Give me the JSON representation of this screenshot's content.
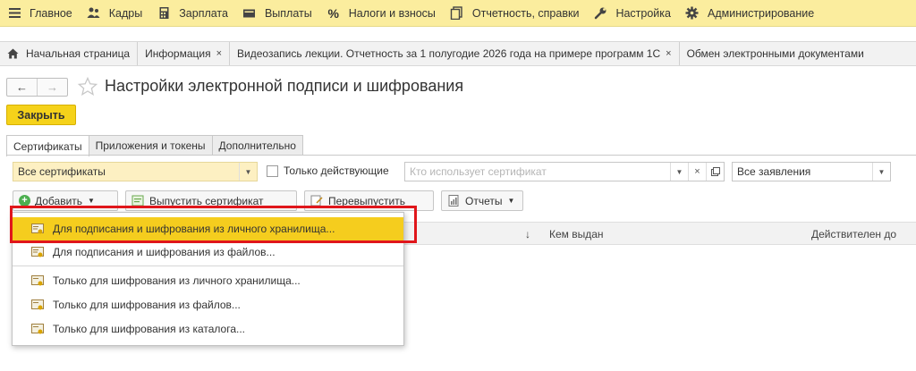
{
  "top_menu": [
    {
      "label": "Главное",
      "icon": "menu-lines-icon"
    },
    {
      "label": "Кадры",
      "icon": "people-icon"
    },
    {
      "label": "Зарплата",
      "icon": "calculator-icon"
    },
    {
      "label": "Выплаты",
      "icon": "wallet-icon"
    },
    {
      "label": "Налоги и взносы",
      "icon": "percent-icon"
    },
    {
      "label": "Отчетность, справки",
      "icon": "documents-icon"
    },
    {
      "label": "Настройка",
      "icon": "wrench-icon"
    },
    {
      "label": "Администрирование",
      "icon": "gear-icon"
    }
  ],
  "open_tabs": {
    "home": "Начальная страница",
    "items": [
      {
        "label": "Информация"
      },
      {
        "label": "Видеозапись лекции. Отчетность за 1 полугодие 2026 года на примере программ 1С"
      },
      {
        "label": "Обмен электронными документами"
      }
    ],
    "close_glyph": "×"
  },
  "page": {
    "title": "Настройки электронной подписи и шифрования",
    "back_glyph": "←",
    "forward_glyph": "→",
    "close_button": "Закрыть"
  },
  "form_tabs": [
    "Сертификаты",
    "Приложения и токены",
    "Дополнительно"
  ],
  "filters": {
    "certificates_value": "Все сертификаты",
    "only_active_label": "Только действующие",
    "user_placeholder": "Кто использует сертификат",
    "applications_value": "Все заявления"
  },
  "toolbar": {
    "add_label": "Добавить",
    "issue_label": "Выпустить сертификат",
    "reissue_label": "Перевыпустить",
    "reports_label": "Отчеты"
  },
  "table": {
    "sort_glyph": "↓",
    "columns": [
      "Кем выдан",
      "Действителен до"
    ]
  },
  "add_menu": {
    "items": [
      "Для подписания и шифрования из личного хранилища...",
      "Для подписания и шифрования из файлов...",
      "Только для шифрования из личного хранилища...",
      "Только для шифрования из файлов...",
      "Только для шифрования из каталога..."
    ],
    "selected_index": 0
  },
  "colors": {
    "menu_bg": "#fbed9e",
    "accent_yellow": "#f5d21a",
    "highlight_red": "#e0161b"
  }
}
